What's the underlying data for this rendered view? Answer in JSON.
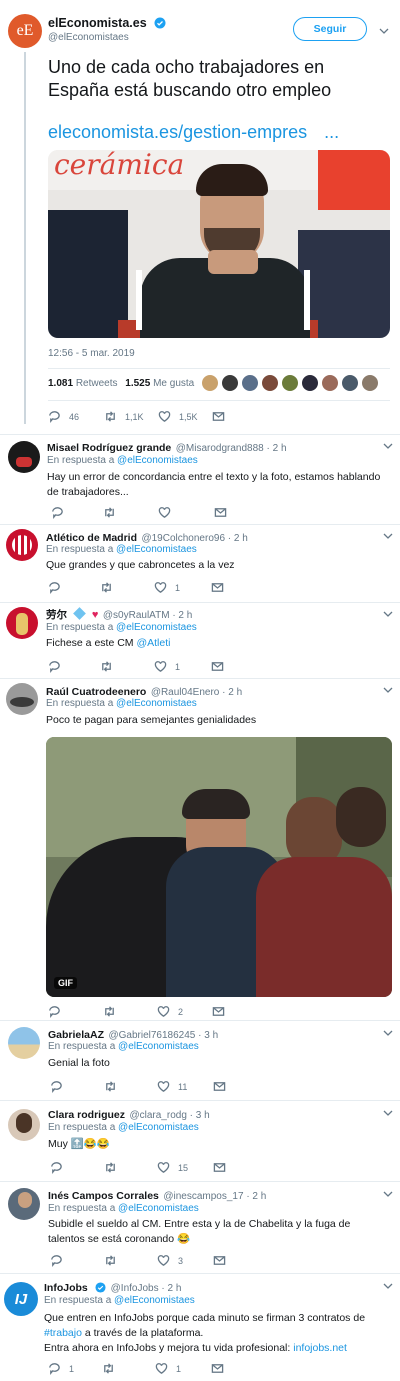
{
  "main_tweet": {
    "author_name": "elEconomista.es",
    "handle": "@elEconomistaes",
    "avatar_initials": "eE",
    "follow_label": "Seguir",
    "text": "Uno de cada ocho trabajadores en España está buscando otro empleo",
    "link": "eleconomista.es/gestion-empres",
    "link_ellipsis": "...",
    "image_banner": "cerámica",
    "timestamp": "12:56 - 5 mar. 2019",
    "retweets_count": "1.081",
    "retweets_label": "Retweets",
    "likes_count": "1.525",
    "likes_label": "Me gusta",
    "replies": "46",
    "rt": "1,1K",
    "likes": "1,5K"
  },
  "replies": [
    {
      "name": "Misael Rodríguez grande",
      "meta": "@Misarodgrand888 · 2 h",
      "reply_prefix": "En respuesta a",
      "reply_to": "@elEconomistaes",
      "text": "Hay un error de concordancia entre el texto y la foto, estamos hablando de trabajadores...",
      "c_reply": "",
      "c_rt": "",
      "c_like": ""
    },
    {
      "name": "Atlético de Madrid",
      "meta": "@19Colchonero96 · 2 h",
      "reply_prefix": "En respuesta a",
      "reply_to": "@elEconomistaes",
      "text": "Que grandes y que cabroncetes a la vez",
      "c_reply": "",
      "c_rt": "",
      "c_like": "1"
    },
    {
      "name": "劳尔",
      "meta": "@s0yRaulATM · 2 h",
      "reply_prefix": "En respuesta a",
      "reply_to": "@elEconomistaes",
      "text": "Fichese a este CM",
      "text_link": "@Atleti",
      "c_reply": "",
      "c_rt": "",
      "c_like": "1"
    },
    {
      "name": "Raúl Cuatrodeenero",
      "meta": "@Raul04Enero · 2 h",
      "reply_prefix": "En respuesta a",
      "reply_to": "@elEconomistaes",
      "text": "Poco te pagan para semejantes genialidades",
      "gif_label": "GIF",
      "c_reply": "",
      "c_rt": "",
      "c_like": "2"
    },
    {
      "name": "GabrielaAZ",
      "meta": "@Gabriel76186245 · 3 h",
      "reply_prefix": "En respuesta a",
      "reply_to": "@elEconomistaes",
      "text": "Genial la foto",
      "c_reply": "",
      "c_rt": "",
      "c_like": "11"
    },
    {
      "name": "Clara rodriguez",
      "meta": "@clara_rodg · 3 h",
      "reply_prefix": "En respuesta a",
      "reply_to": "@elEconomistaes",
      "text": "Muy 🔝😂😂",
      "c_reply": "",
      "c_rt": "",
      "c_like": "15"
    },
    {
      "name": "Inés Campos Corrales",
      "meta": "@inescampos_17 · 2 h",
      "reply_prefix": "En respuesta a",
      "reply_to": "@elEconomistaes",
      "text": "Subidle el sueldo al CM. Entre esta y la de Chabelita y la fuga de talentos se está coronando 😂",
      "c_reply": "",
      "c_rt": "",
      "c_like": "3"
    },
    {
      "name": "InfoJobs",
      "meta": "@InfoJobs · 2 h",
      "reply_prefix": "En respuesta a",
      "reply_to": "@elEconomistaes",
      "avatar_initial": "IJ",
      "text_a": "Que entren en InfoJobs porque cada minuto se firman 3 contratos de",
      "text_hashtag": "#trabajo",
      "text_b": "a través de la plataforma.",
      "text_c": "Entra ahora en InfoJobs y mejora tu vida profesional:",
      "text_link": "infojobs.net",
      "c_reply": "1",
      "c_rt": "",
      "c_like": "1"
    }
  ],
  "colors": {
    "accent": "#1b95e0",
    "muted": "#657786",
    "border": "#e6ecf0"
  }
}
